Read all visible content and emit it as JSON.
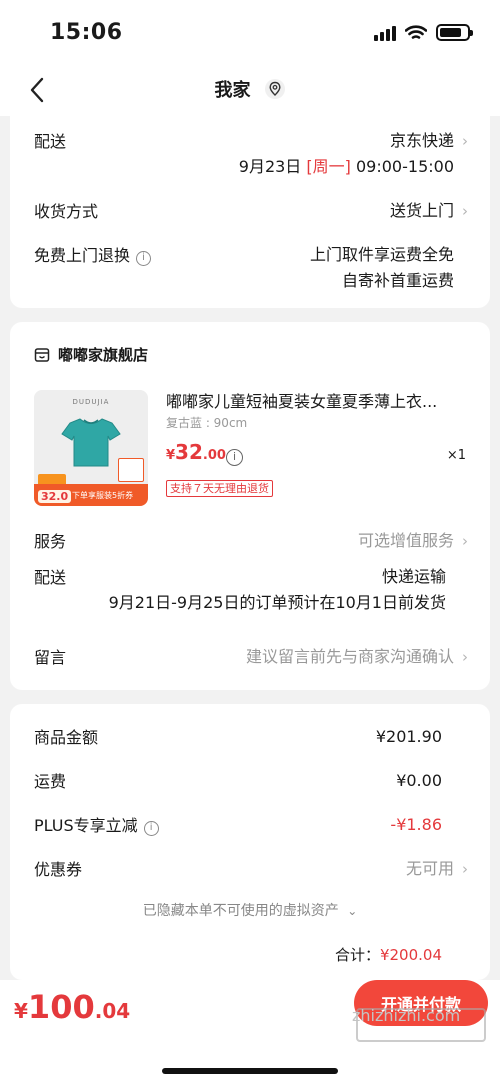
{
  "status_bar": {
    "time": "15:06"
  },
  "nav": {
    "title": "我家"
  },
  "delivery": {
    "shipping_label": "配送",
    "shipping_carrier": "京东快递",
    "shipping_date": "9月23日",
    "shipping_weekday": "[周一]",
    "shipping_time": "09:00-15:00",
    "receive_label": "收货方式",
    "receive_value": "送货上门",
    "return_label": "免费上门退换",
    "return_line1": "上门取件享运费全免",
    "return_line2": "自寄补首重运费"
  },
  "shop": {
    "name": "嘟嘟家旗舰店",
    "product": {
      "brand_on_image": "DUDUJIA",
      "promo_price": "32.0",
      "promo_text": "下单享服装5折券",
      "title": "嘟嘟家儿童短袖夏装女童夏季薄上衣...",
      "spec": "复古蓝 : 90cm",
      "price_symbol": "¥",
      "price_int": "32",
      "price_dec": ".00",
      "qty": "×1",
      "tag": "支持７天无理由退货"
    },
    "service_label": "服务",
    "service_value": "可选增值服务",
    "shipping_label": "配送",
    "shipping_value": "快递运输",
    "shipping_note": "9月21日-9月25日的订单预计在10月1日前发货",
    "message_label": "留言",
    "message_placeholder": "建议留言前先与商家沟通确认"
  },
  "summary": {
    "goods_label": "商品金额",
    "goods_value": "¥201.90",
    "freight_label": "运费",
    "freight_value": "¥0.00",
    "plus_label": "PLUS专享立减",
    "plus_value": "-¥1.86",
    "coupon_label": "优惠券",
    "coupon_value": "无可用",
    "hidden_assets": "已隐藏本单不可使用的虚拟资产",
    "total_label": "合计：",
    "total_value": "¥200.04"
  },
  "bottom": {
    "pay_symbol": "¥",
    "pay_int": "100",
    "pay_dec": ".04",
    "pay_button": "开通并付款"
  },
  "watermark": "zhizhizhi.com",
  "colors": {
    "accent": "#e4393c",
    "button": "#f2473b",
    "background": "#f2f2f2"
  }
}
